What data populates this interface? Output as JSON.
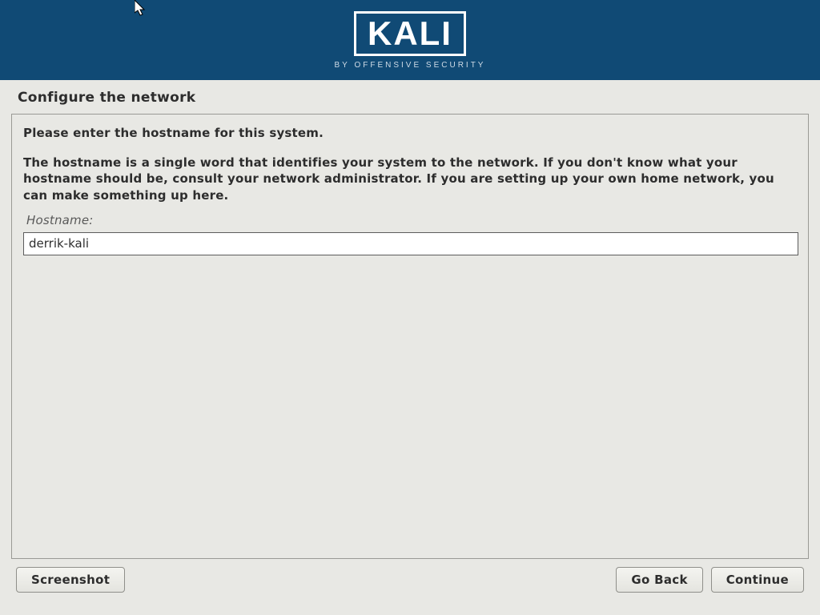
{
  "banner": {
    "logo_text": "KALI",
    "logo_sub": "BY OFFENSIVE SECURITY"
  },
  "page": {
    "title": "Configure the network",
    "prompt": "Please enter the hostname for this system.",
    "description": "The hostname is a single word that identifies your system to the network. If you don't know what your hostname should be, consult your network administrator. If you are setting up your own home network, you can make something up here.",
    "field_label": "Hostname:",
    "hostname_value": "derrik-kali"
  },
  "buttons": {
    "screenshot": "Screenshot",
    "go_back": "Go Back",
    "cont": "Continue"
  }
}
